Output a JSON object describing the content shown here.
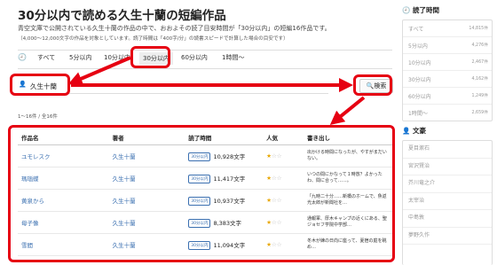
{
  "page": {
    "title": "30分以内で読める久生十蘭の短編作品",
    "description": "青空文庫で公開されている久生十蘭の作品の中で、おおよその読了目安時間が「30分以内」の短編16作品です。",
    "note": "（4,000〜12,000文字の作品を対象としています。読了時間は「400字/分」の読書スピードで計算した場合の目安です）"
  },
  "tabs": [
    {
      "label": "すべて"
    },
    {
      "label": "5分以内"
    },
    {
      "label": "10分以内"
    },
    {
      "label": "30分以内",
      "active": true
    },
    {
      "label": "60分以内"
    },
    {
      "label": "1時間〜"
    }
  ],
  "search": {
    "value": "久生十蘭",
    "button_label": "検索"
  },
  "result_count": "1〜16件 / 全16件",
  "table": {
    "headers": [
      "作品名",
      "著者",
      "読了時間",
      "人気",
      "書き出し"
    ],
    "badge_label": "30分以内",
    "rows": [
      {
        "title": "ユモレスク",
        "author": "久生十蘭",
        "chars": "10,928文字",
        "stars": 1,
        "excerpt": "出かける時間になったが、やすがまだいない。"
      },
      {
        "title": "瑪瑙蝶",
        "author": "久生十蘭",
        "chars": "11,417文字",
        "stars": 1,
        "excerpt": "いつの間にかなって１時放？よかったわ、間に合って……。"
      },
      {
        "title": "黄泉から",
        "author": "久生十蘭",
        "chars": "10,937文字",
        "stars": 1,
        "excerpt": "「九時二十分……新橋のホームで、魚返光太郎が新聞社を…"
      },
      {
        "title": "母子像",
        "author": "久生十蘭",
        "chars": "8,383文字",
        "stars": 1,
        "excerpt": "通報軍、厚木キャンプの近くにある、聖ジョセフ学院中学部…"
      },
      {
        "title": "雪間",
        "author": "久生十蘭",
        "chars": "11,094文字",
        "stars": 1,
        "excerpt": "冬木が練の日向に座って、夏宿の庭を眺め…"
      }
    ]
  },
  "sidebar": {
    "time_heading": "読了時間",
    "time_items": [
      {
        "label": "すべて",
        "count": "14,815件"
      },
      {
        "label": "5分以内",
        "count": "4,276件"
      },
      {
        "label": "10分以内",
        "count": "2,467件"
      },
      {
        "label": "30分以内",
        "count": "4,162件"
      },
      {
        "label": "60分以内",
        "count": "1,249件"
      },
      {
        "label": "1時間〜",
        "count": "2,659件"
      }
    ],
    "author_heading": "文豪",
    "authors": [
      "夏目漱石",
      "宮沢賢治",
      "芥川竜之介",
      "太宰治",
      "中島敦",
      "夢野久作"
    ]
  },
  "colors": {
    "accent": "#3a6fb0",
    "highlight": "#e60012",
    "star": "#e8a700"
  },
  "icons": {
    "clock": "clock-icon",
    "user": "user-icon",
    "search": "search-icon"
  }
}
